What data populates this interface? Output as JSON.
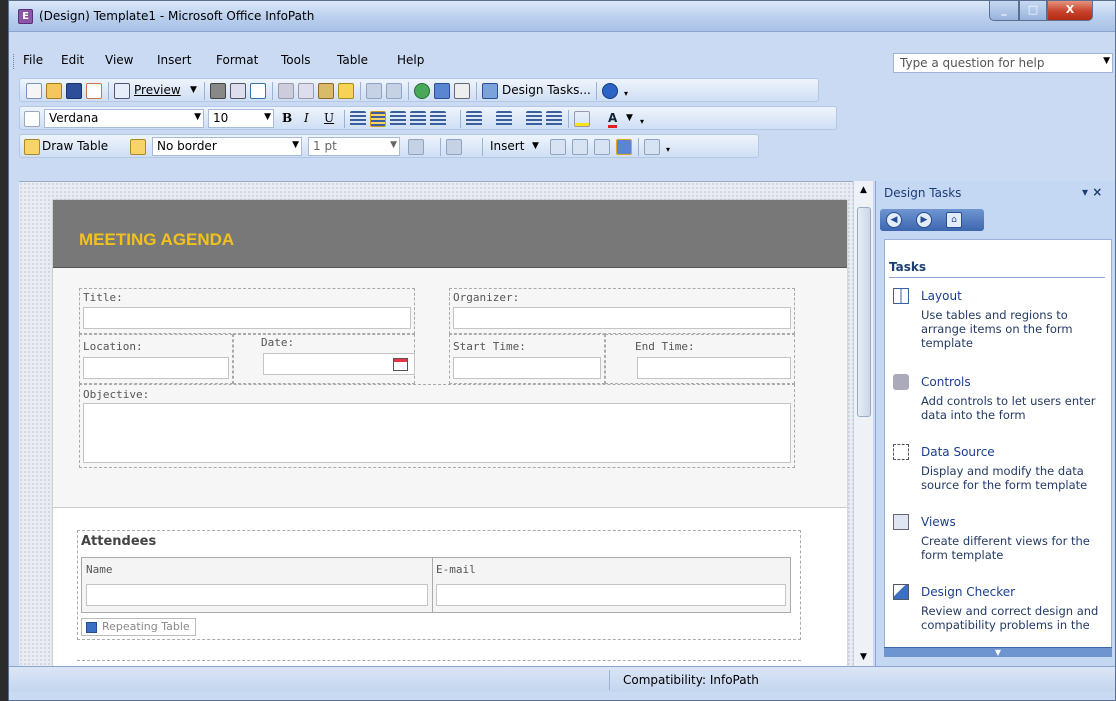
{
  "window": {
    "title": "(Design) Template1 - Microsoft Office InfoPath",
    "app_icon": "infopath-icon",
    "controls": {
      "minimize": "_",
      "maximize": "□",
      "close": "X"
    }
  },
  "menubar": {
    "items": [
      "File",
      "Edit",
      "View",
      "Insert",
      "Format",
      "Tools",
      "Table",
      "Help"
    ],
    "help_placeholder": "Type a question for help"
  },
  "standard_toolbar": {
    "preview_label": "Preview",
    "design_tasks_label": "Design Tasks..."
  },
  "format_toolbar": {
    "font": "Verdana",
    "size": "10",
    "bold": "B",
    "italic": "I",
    "underline": "U",
    "font_color": "A"
  },
  "table_toolbar": {
    "draw_table": "Draw Table",
    "border_style": "No border",
    "border_width": "1 pt",
    "insert_label": "Insert"
  },
  "form": {
    "banner_title": "MEETING AGENDA",
    "title_label": "Title:",
    "organizer_label": "Organizer:",
    "location_label": "Location:",
    "date_label": "Date:",
    "start_time_label": "Start Time:",
    "end_time_label": "End Time:",
    "objective_label": "Objective:",
    "attendees": {
      "title": "Attendees",
      "columns": [
        "Name",
        "E-mail"
      ],
      "repeating_tag": "Repeating Table"
    }
  },
  "task_pane": {
    "title": "Design Tasks",
    "section": "Tasks",
    "tasks": [
      {
        "label": "Layout",
        "desc": "Use tables and regions to arrange items on the form template",
        "icon": "layout-icon"
      },
      {
        "label": "Controls",
        "desc": "Add controls to let users enter data into the form",
        "icon": "controls-icon"
      },
      {
        "label": "Data Source",
        "desc": "Display and modify the data source for the form template",
        "icon": "data-source-icon"
      },
      {
        "label": "Views",
        "desc": "Create different views for the form template",
        "icon": "views-icon"
      },
      {
        "label": "Design Checker",
        "desc": "Review and correct design and compatibility problems in the",
        "icon": "design-checker-icon"
      }
    ]
  },
  "status": {
    "compatibility": "Compatibility: InfoPath"
  }
}
